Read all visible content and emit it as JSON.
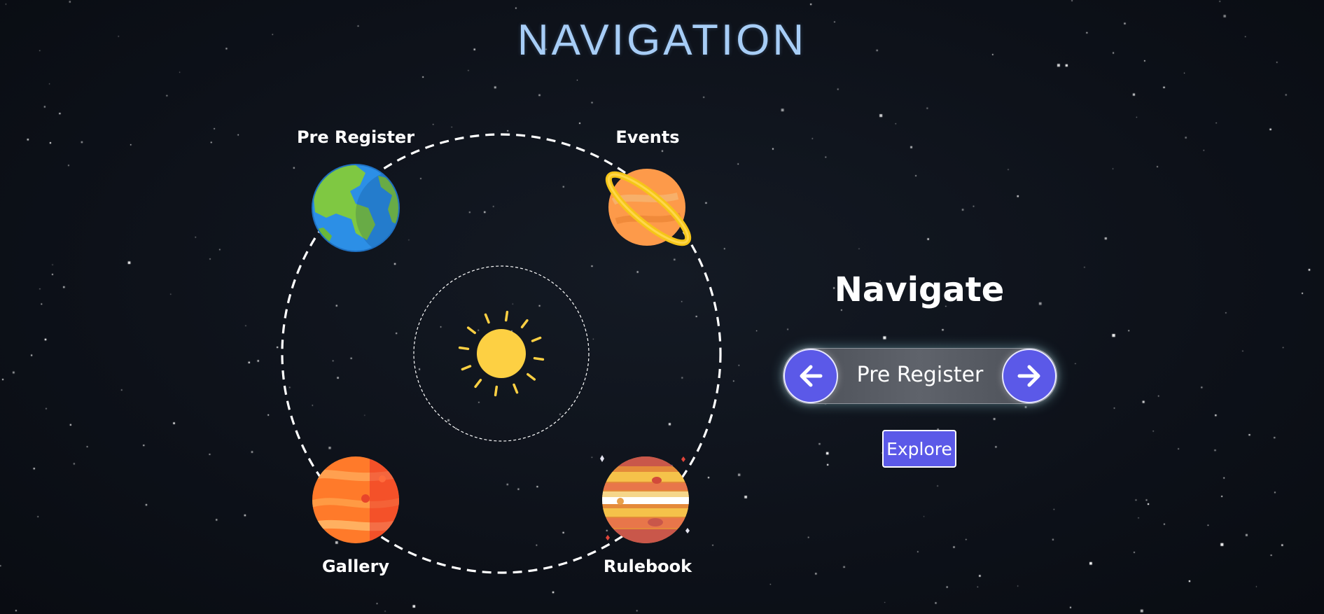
{
  "page": {
    "title": "NAVIGATION"
  },
  "planets": [
    {
      "label": "Pre Register",
      "icon": "earth-planet-icon"
    },
    {
      "label": "Events",
      "icon": "saturn-planet-icon"
    },
    {
      "label": "Gallery",
      "icon": "mars-planet-icon"
    },
    {
      "label": "Rulebook",
      "icon": "jupiter-planet-icon"
    }
  ],
  "center": {
    "icon": "sun-icon"
  },
  "panel": {
    "heading": "Navigate",
    "selected": "Pre Register",
    "prev_icon": "arrow-left-icon",
    "next_icon": "arrow-right-icon",
    "explore_label": "Explore"
  },
  "colors": {
    "background": "#0d1119",
    "title": "#a7cdf6",
    "accent": "#5b59e8",
    "orbit": "#ffffff",
    "sun": "#fdd043"
  }
}
